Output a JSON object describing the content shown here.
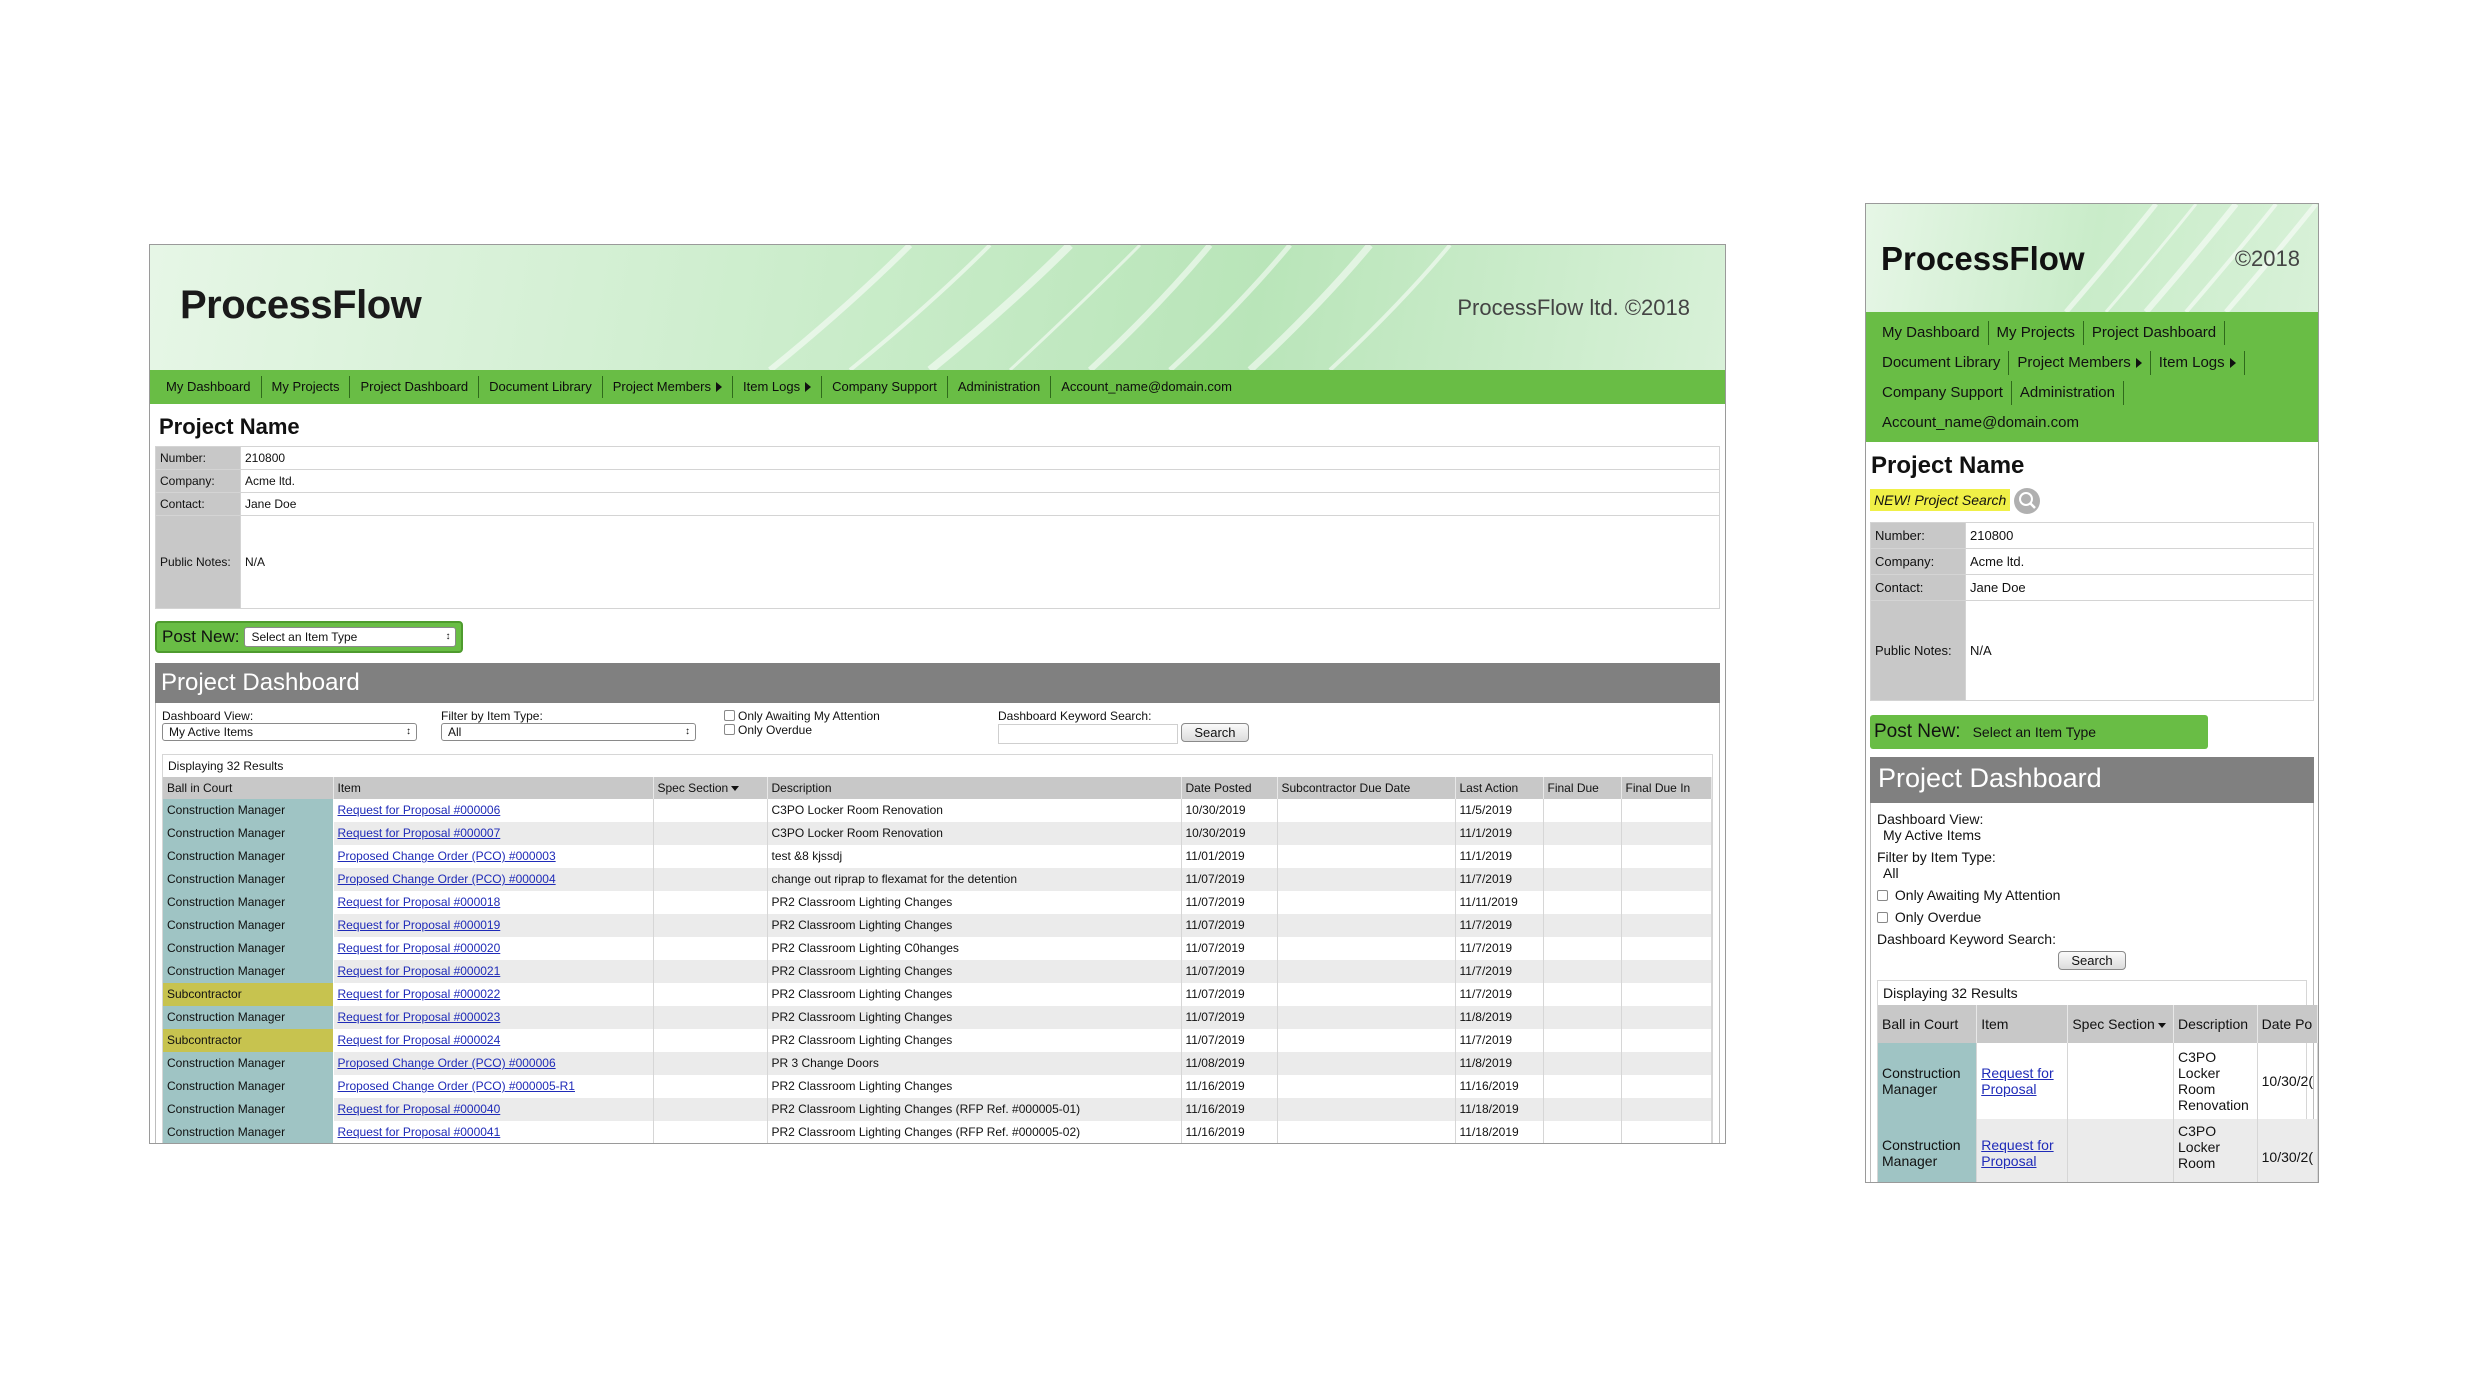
{
  "brand": {
    "name": "ProcessFlow",
    "copyright_desktop": "ProcessFlow ltd. ©2018",
    "copyright_mobile": "©2018"
  },
  "nav": {
    "my_dashboard": "My Dashboard",
    "my_projects": "My Projects",
    "project_dashboard": "Project Dashboard",
    "document_library": "Document Library",
    "project_members": "Project Members",
    "item_logs": "Item Logs",
    "company_support": "Company Support",
    "administration": "Administration",
    "account": "Account_name@domain.com"
  },
  "project": {
    "title": "Project Name",
    "search_label": "NEW! Project Search",
    "number_label": "Number:",
    "number": "210800",
    "company_label": "Company:",
    "company": "Acme ltd.",
    "contact_label": "Contact:",
    "contact": "Jane Doe",
    "notes_label": "Public Notes:",
    "notes": "N/A"
  },
  "post_new": {
    "label": "Post New:",
    "select": "Select an Item Type"
  },
  "dashboard": {
    "title": "Project Dashboard",
    "view_label": "Dashboard View:",
    "view_value": "My Active Items",
    "filter_label": "Filter by Item Type:",
    "filter_value": "All",
    "awaiting_label": "Only Awaiting My Attention",
    "overdue_label": "Only Overdue",
    "keyword_label": "Dashboard Keyword Search:",
    "search_button": "Search",
    "results_count": "Displaying 32 Results"
  },
  "table": {
    "headers": [
      "Ball in Court",
      "Item",
      "Spec Section",
      "Description",
      "Date Posted",
      "Subcontractor Due Date",
      "Last Action",
      "Final Due",
      "Final Due In"
    ],
    "rows": [
      [
        "Construction Manager",
        "Request for Proposal #000006",
        "",
        "C3PO Locker Room Renovation",
        "10/30/2019",
        "",
        "11/5/2019",
        "",
        ""
      ],
      [
        "Construction Manager",
        "Request for Proposal #000007",
        "",
        "C3PO Locker Room Renovation",
        "10/30/2019",
        "",
        "11/1/2019",
        "",
        ""
      ],
      [
        "Construction Manager",
        "Proposed Change Order (PCO) #000003",
        "",
        "test &8 kjssdj",
        "11/01/2019",
        "",
        "11/1/2019",
        "",
        ""
      ],
      [
        "Construction Manager",
        "Proposed Change Order (PCO) #000004",
        "",
        "change out riprap to flexamat for the detention",
        "11/07/2019",
        "",
        "11/7/2019",
        "",
        ""
      ],
      [
        "Construction Manager",
        "Request for Proposal #000018",
        "",
        "PR2 Classroom Lighting Changes",
        "11/07/2019",
        "",
        "11/11/2019",
        "",
        ""
      ],
      [
        "Construction Manager",
        "Request for Proposal #000019",
        "",
        "PR2 Classroom Lighting Changes",
        "11/07/2019",
        "",
        "11/7/2019",
        "",
        ""
      ],
      [
        "Construction Manager",
        "Request for Proposal #000020",
        "",
        "PR2 Classroom Lighting C0hanges",
        "11/07/2019",
        "",
        "11/7/2019",
        "",
        ""
      ],
      [
        "Construction Manager",
        "Request for Proposal #000021",
        "",
        "PR2 Classroom Lighting Changes",
        "11/07/2019",
        "",
        "11/7/2019",
        "",
        ""
      ],
      [
        "Subcontractor",
        "Request for Proposal #000022",
        "",
        "PR2 Classroom Lighting Changes",
        "11/07/2019",
        "",
        "11/7/2019",
        "",
        ""
      ],
      [
        "Construction Manager",
        "Request for Proposal #000023",
        "",
        "PR2 Classroom Lighting Changes",
        "11/07/2019",
        "",
        "11/8/2019",
        "",
        ""
      ],
      [
        "Subcontractor",
        "Request for Proposal #000024",
        "",
        "PR2 Classroom Lighting Changes",
        "11/07/2019",
        "",
        "11/7/2019",
        "",
        ""
      ],
      [
        "Construction Manager",
        "Proposed Change Order (PCO) #000006",
        "",
        "PR 3 Change Doors",
        "11/08/2019",
        "",
        "11/8/2019",
        "",
        ""
      ],
      [
        "Construction Manager",
        "Proposed Change Order (PCO) #000005-R1",
        "",
        "PR2 Classroom Lighting Changes",
        "11/16/2019",
        "",
        "11/16/2019",
        "",
        ""
      ],
      [
        "Construction Manager",
        "Request for Proposal #000040",
        "",
        "PR2 Classroom Lighting Changes (RFP Ref. #000005-01)",
        "11/16/2019",
        "",
        "11/18/2019",
        "",
        ""
      ],
      [
        "Construction Manager",
        "Request for Proposal #000041",
        "",
        "PR2 Classroom Lighting Changes (RFP Ref. #000005-02)",
        "11/16/2019",
        "",
        "11/18/2019",
        "",
        ""
      ]
    ]
  },
  "mobile_table": {
    "headers": [
      "Ball in Court",
      "Item",
      "Spec Section",
      "Description",
      "Date Po"
    ],
    "rows": [
      {
        "ball": "Construction Manager",
        "item": "Request for Proposal",
        "desc": "C3PO Locker Room Renovation",
        "date": "10/30/2("
      },
      {
        "ball": "Construction Manager",
        "item": "Request for Proposal",
        "desc": "C3PO Locker Room",
        "date": "10/30/2("
      }
    ]
  }
}
